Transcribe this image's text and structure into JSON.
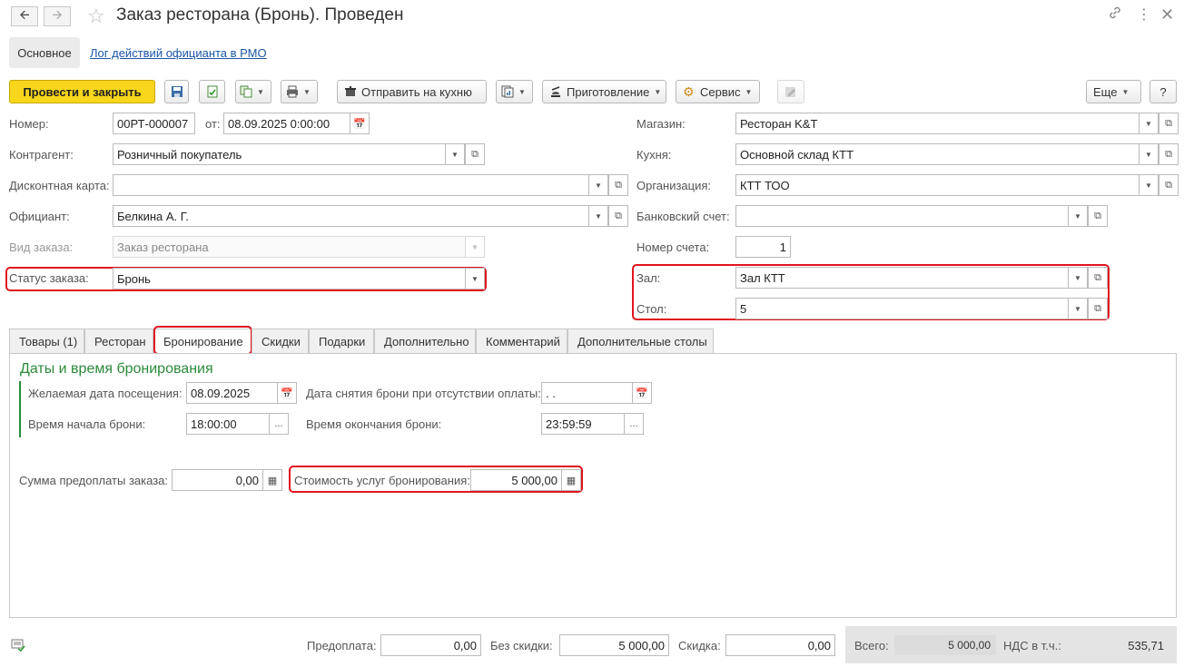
{
  "window": {
    "title": "Заказ ресторана (Бронь). Проведен",
    "back_icon": "arrow-left-icon",
    "forward_icon": "arrow-right-icon",
    "favorite_icon": "star-icon",
    "link_icon": "link-icon",
    "more_icon": "more-vertical-icon",
    "close_icon": "close-icon"
  },
  "nav": {
    "main_label": "Основное",
    "log_link": "Лог действий официанта в РМО"
  },
  "toolbar": {
    "post_close": "Провести и закрыть",
    "send_kitchen": "Отправить на кухню",
    "cooking": "Приготовление",
    "service": "Сервис",
    "more": "Еще",
    "help": "?"
  },
  "form": {
    "number_label": "Номер:",
    "number_value": "00РТ-000007",
    "from_label": "от:",
    "date_value": "08.09.2025  0:00:00",
    "counterparty_label": "Контрагент:",
    "counterparty_value": "Розничный покупатель",
    "discount_card_label": "Дисконтная карта:",
    "discount_card_value": "",
    "waiter_label": "Официант:",
    "waiter_value": "Белкина А. Г.",
    "order_type_label": "Вид заказа:",
    "order_type_value": "Заказ ресторана",
    "status_label": "Статус заказа:",
    "status_value": "Бронь",
    "store_label": "Магазин:",
    "store_value": "Ресторан K&T",
    "kitchen_label": "Кухня:",
    "kitchen_value": "Основной склад КТТ",
    "org_label": "Организация:",
    "org_value": "КТТ ТОО",
    "bank_label": "Банковский счет:",
    "bank_value": "",
    "invoice_label": "Номер счета:",
    "invoice_value": "1",
    "hall_label": "Зал:",
    "hall_value": "Зал КТТ",
    "table_label": "Стол:",
    "table_value": "5"
  },
  "tabs": [
    {
      "label": "Товары (1)"
    },
    {
      "label": "Ресторан"
    },
    {
      "label": "Бронирование"
    },
    {
      "label": "Скидки"
    },
    {
      "label": "Подарки"
    },
    {
      "label": "Дополнительно"
    },
    {
      "label": "Комментарий"
    },
    {
      "label": "Дополнительные столы"
    }
  ],
  "booking": {
    "section_title": "Даты и время бронирования",
    "visit_date_label": "Желаемая дата посещения:",
    "visit_date_value": "08.09.2025",
    "cancel_date_label": "Дата снятия брони при отсутствии оплаты:",
    "cancel_date_value": " .  .",
    "start_time_label": "Время начала брони:",
    "start_time_value": "18:00:00",
    "end_time_label": "Время окончания брони:",
    "end_time_value": "23:59:59",
    "prepay_label": "Сумма предоплаты заказа:",
    "prepay_value": "0,00",
    "cost_label": "Стоимость услуг бронирования:",
    "cost_value": "5 000,00",
    "ellipsis": "..."
  },
  "footer": {
    "prepayment_label": "Предоплата:",
    "prepayment_value": "0,00",
    "no_discount_label": "Без скидки:",
    "no_discount_value": "5 000,00",
    "discount_label": "Скидка:",
    "discount_value": "0,00",
    "total_label": "Всего:",
    "total_value": "5 000,00",
    "vat_label": "НДС в т.ч.:",
    "vat_value": "535,71"
  },
  "colors": {
    "primary_button": "#f7d61b",
    "highlight": "#e0141e",
    "section_title": "#2a8a3a",
    "link": "#1a55a8"
  }
}
